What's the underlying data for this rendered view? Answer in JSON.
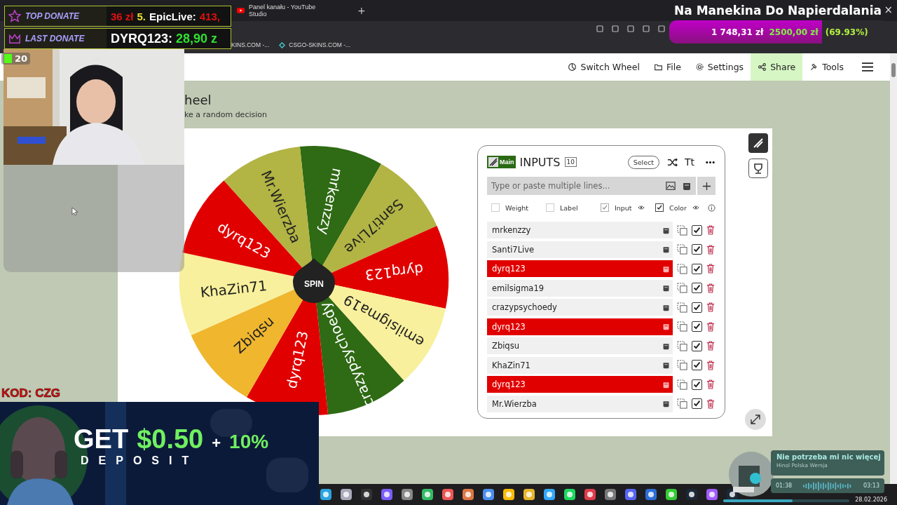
{
  "browser": {
    "tabs": [
      {
        "title": "Panel kanału - YouTube Studio",
        "selected": false
      }
    ],
    "new_tab": "+",
    "bookmarks": [
      "KINS.COM -...",
      "CSGO-SKINS.COM -..."
    ]
  },
  "nav": [
    {
      "label": "Switch Wheel",
      "selected": false
    },
    {
      "label": "File",
      "selected": false
    },
    {
      "label": "Settings",
      "selected": false
    },
    {
      "label": "Share",
      "selected": true
    },
    {
      "label": "Tools",
      "selected": false
    }
  ],
  "page": {
    "title": "heel",
    "subtitle": "ke a random decision"
  },
  "wheel": {
    "spin_label": "SPIN",
    "segments": [
      {
        "label": "mrkenzzy",
        "color": "#2f6a14"
      },
      {
        "label": "Santi7Live",
        "color": "#b2b444"
      },
      {
        "label": "dyrq123",
        "color": "#e10000"
      },
      {
        "label": "emilsigma19",
        "color": "#f8f09c"
      },
      {
        "label": "crazypsychoedy",
        "color": "#2f6a14"
      },
      {
        "label": "dyrq123",
        "color": "#e10000"
      },
      {
        "label": "Zbiqsu",
        "color": "#efb62e"
      },
      {
        "label": "KhaZin71",
        "color": "#f8f09c"
      },
      {
        "label": "dyrq123",
        "color": "#e10000"
      },
      {
        "label": "Mr.Wierzba",
        "color": "#b2b444"
      }
    ]
  },
  "inputs": {
    "badge": "Main",
    "title": "INPUTS",
    "count": "10",
    "select_label": "Select",
    "font_button": "Tt",
    "placeholder": "Type or paste multiple lines...",
    "options": [
      {
        "label": "Weight",
        "checked": false,
        "disabled": false,
        "eye": false
      },
      {
        "label": "Label",
        "checked": false,
        "disabled": false,
        "eye": false
      },
      {
        "label": "Input",
        "checked": true,
        "disabled": true,
        "eye": true
      },
      {
        "label": "Color",
        "checked": true,
        "disabled": false,
        "eye": true
      }
    ],
    "entries": [
      {
        "name": "mrkenzzy",
        "highlighted": false,
        "checked": true
      },
      {
        "name": "Santi7Live",
        "highlighted": false,
        "checked": true
      },
      {
        "name": "dyrq123",
        "highlighted": true,
        "checked": true
      },
      {
        "name": "emilsigma19",
        "highlighted": false,
        "checked": true
      },
      {
        "name": "crazypsychoedy",
        "highlighted": false,
        "checked": true
      },
      {
        "name": "dyrq123",
        "highlighted": true,
        "checked": true
      },
      {
        "name": "Zbiqsu",
        "highlighted": false,
        "checked": true
      },
      {
        "name": "KhaZin71",
        "highlighted": false,
        "checked": true
      },
      {
        "name": "dyrq123",
        "highlighted": true,
        "checked": true
      },
      {
        "name": "Mr.Wierzba",
        "highlighted": false,
        "checked": true
      }
    ]
  },
  "overlay": {
    "top_donate": {
      "label": "TOP DONATE",
      "amount": "36 zł",
      "rank": "5.",
      "name": "EpicLive:",
      "value": "413,"
    },
    "last_donate": {
      "label": "LAST DONATE",
      "name": "DYRQ123:",
      "amount": "28,90 z"
    },
    "viewer_count": "20",
    "code": "KOD: CZG",
    "stream_title": "Na Manekina Do Napierdalania",
    "close": "×",
    "goal": {
      "current": "1 748,31 zł",
      "target": "2500,00 zł",
      "percent": "(69.93%)",
      "level": 0.6993
    },
    "ad": {
      "get": "GET",
      "amount": "$0.50",
      "plus": "+",
      "bonus": "10%",
      "deposit": "DEPOSIT"
    },
    "now_playing": {
      "title": "Nie potrzeba mi nic więcej",
      "artist": "Hinol Polska Wersja",
      "elapsed": "01:38",
      "duration": "03:13",
      "level": 0.55
    }
  },
  "taskbar": {
    "date": "28.02.2026"
  }
}
